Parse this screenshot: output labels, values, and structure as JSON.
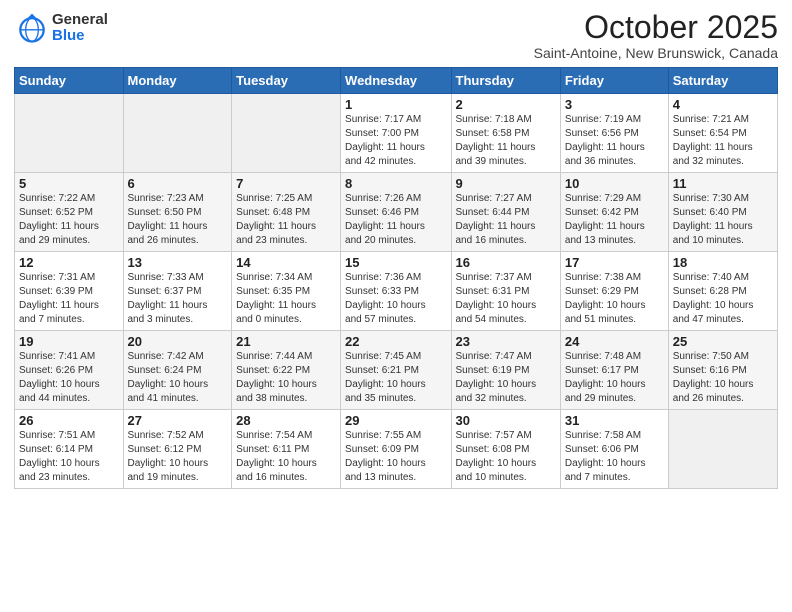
{
  "header": {
    "logo_general": "General",
    "logo_blue": "Blue",
    "month_title": "October 2025",
    "location": "Saint-Antoine, New Brunswick, Canada"
  },
  "weekdays": [
    "Sunday",
    "Monday",
    "Tuesday",
    "Wednesday",
    "Thursday",
    "Friday",
    "Saturday"
  ],
  "weeks": [
    [
      {
        "day": "",
        "info": ""
      },
      {
        "day": "",
        "info": ""
      },
      {
        "day": "",
        "info": ""
      },
      {
        "day": "1",
        "info": "Sunrise: 7:17 AM\nSunset: 7:00 PM\nDaylight: 11 hours\nand 42 minutes."
      },
      {
        "day": "2",
        "info": "Sunrise: 7:18 AM\nSunset: 6:58 PM\nDaylight: 11 hours\nand 39 minutes."
      },
      {
        "day": "3",
        "info": "Sunrise: 7:19 AM\nSunset: 6:56 PM\nDaylight: 11 hours\nand 36 minutes."
      },
      {
        "day": "4",
        "info": "Sunrise: 7:21 AM\nSunset: 6:54 PM\nDaylight: 11 hours\nand 32 minutes."
      }
    ],
    [
      {
        "day": "5",
        "info": "Sunrise: 7:22 AM\nSunset: 6:52 PM\nDaylight: 11 hours\nand 29 minutes."
      },
      {
        "day": "6",
        "info": "Sunrise: 7:23 AM\nSunset: 6:50 PM\nDaylight: 11 hours\nand 26 minutes."
      },
      {
        "day": "7",
        "info": "Sunrise: 7:25 AM\nSunset: 6:48 PM\nDaylight: 11 hours\nand 23 minutes."
      },
      {
        "day": "8",
        "info": "Sunrise: 7:26 AM\nSunset: 6:46 PM\nDaylight: 11 hours\nand 20 minutes."
      },
      {
        "day": "9",
        "info": "Sunrise: 7:27 AM\nSunset: 6:44 PM\nDaylight: 11 hours\nand 16 minutes."
      },
      {
        "day": "10",
        "info": "Sunrise: 7:29 AM\nSunset: 6:42 PM\nDaylight: 11 hours\nand 13 minutes."
      },
      {
        "day": "11",
        "info": "Sunrise: 7:30 AM\nSunset: 6:40 PM\nDaylight: 11 hours\nand 10 minutes."
      }
    ],
    [
      {
        "day": "12",
        "info": "Sunrise: 7:31 AM\nSunset: 6:39 PM\nDaylight: 11 hours\nand 7 minutes."
      },
      {
        "day": "13",
        "info": "Sunrise: 7:33 AM\nSunset: 6:37 PM\nDaylight: 11 hours\nand 3 minutes."
      },
      {
        "day": "14",
        "info": "Sunrise: 7:34 AM\nSunset: 6:35 PM\nDaylight: 11 hours\nand 0 minutes."
      },
      {
        "day": "15",
        "info": "Sunrise: 7:36 AM\nSunset: 6:33 PM\nDaylight: 10 hours\nand 57 minutes."
      },
      {
        "day": "16",
        "info": "Sunrise: 7:37 AM\nSunset: 6:31 PM\nDaylight: 10 hours\nand 54 minutes."
      },
      {
        "day": "17",
        "info": "Sunrise: 7:38 AM\nSunset: 6:29 PM\nDaylight: 10 hours\nand 51 minutes."
      },
      {
        "day": "18",
        "info": "Sunrise: 7:40 AM\nSunset: 6:28 PM\nDaylight: 10 hours\nand 47 minutes."
      }
    ],
    [
      {
        "day": "19",
        "info": "Sunrise: 7:41 AM\nSunset: 6:26 PM\nDaylight: 10 hours\nand 44 minutes."
      },
      {
        "day": "20",
        "info": "Sunrise: 7:42 AM\nSunset: 6:24 PM\nDaylight: 10 hours\nand 41 minutes."
      },
      {
        "day": "21",
        "info": "Sunrise: 7:44 AM\nSunset: 6:22 PM\nDaylight: 10 hours\nand 38 minutes."
      },
      {
        "day": "22",
        "info": "Sunrise: 7:45 AM\nSunset: 6:21 PM\nDaylight: 10 hours\nand 35 minutes."
      },
      {
        "day": "23",
        "info": "Sunrise: 7:47 AM\nSunset: 6:19 PM\nDaylight: 10 hours\nand 32 minutes."
      },
      {
        "day": "24",
        "info": "Sunrise: 7:48 AM\nSunset: 6:17 PM\nDaylight: 10 hours\nand 29 minutes."
      },
      {
        "day": "25",
        "info": "Sunrise: 7:50 AM\nSunset: 6:16 PM\nDaylight: 10 hours\nand 26 minutes."
      }
    ],
    [
      {
        "day": "26",
        "info": "Sunrise: 7:51 AM\nSunset: 6:14 PM\nDaylight: 10 hours\nand 23 minutes."
      },
      {
        "day": "27",
        "info": "Sunrise: 7:52 AM\nSunset: 6:12 PM\nDaylight: 10 hours\nand 19 minutes."
      },
      {
        "day": "28",
        "info": "Sunrise: 7:54 AM\nSunset: 6:11 PM\nDaylight: 10 hours\nand 16 minutes."
      },
      {
        "day": "29",
        "info": "Sunrise: 7:55 AM\nSunset: 6:09 PM\nDaylight: 10 hours\nand 13 minutes."
      },
      {
        "day": "30",
        "info": "Sunrise: 7:57 AM\nSunset: 6:08 PM\nDaylight: 10 hours\nand 10 minutes."
      },
      {
        "day": "31",
        "info": "Sunrise: 7:58 AM\nSunset: 6:06 PM\nDaylight: 10 hours\nand 7 minutes."
      },
      {
        "day": "",
        "info": ""
      }
    ]
  ]
}
